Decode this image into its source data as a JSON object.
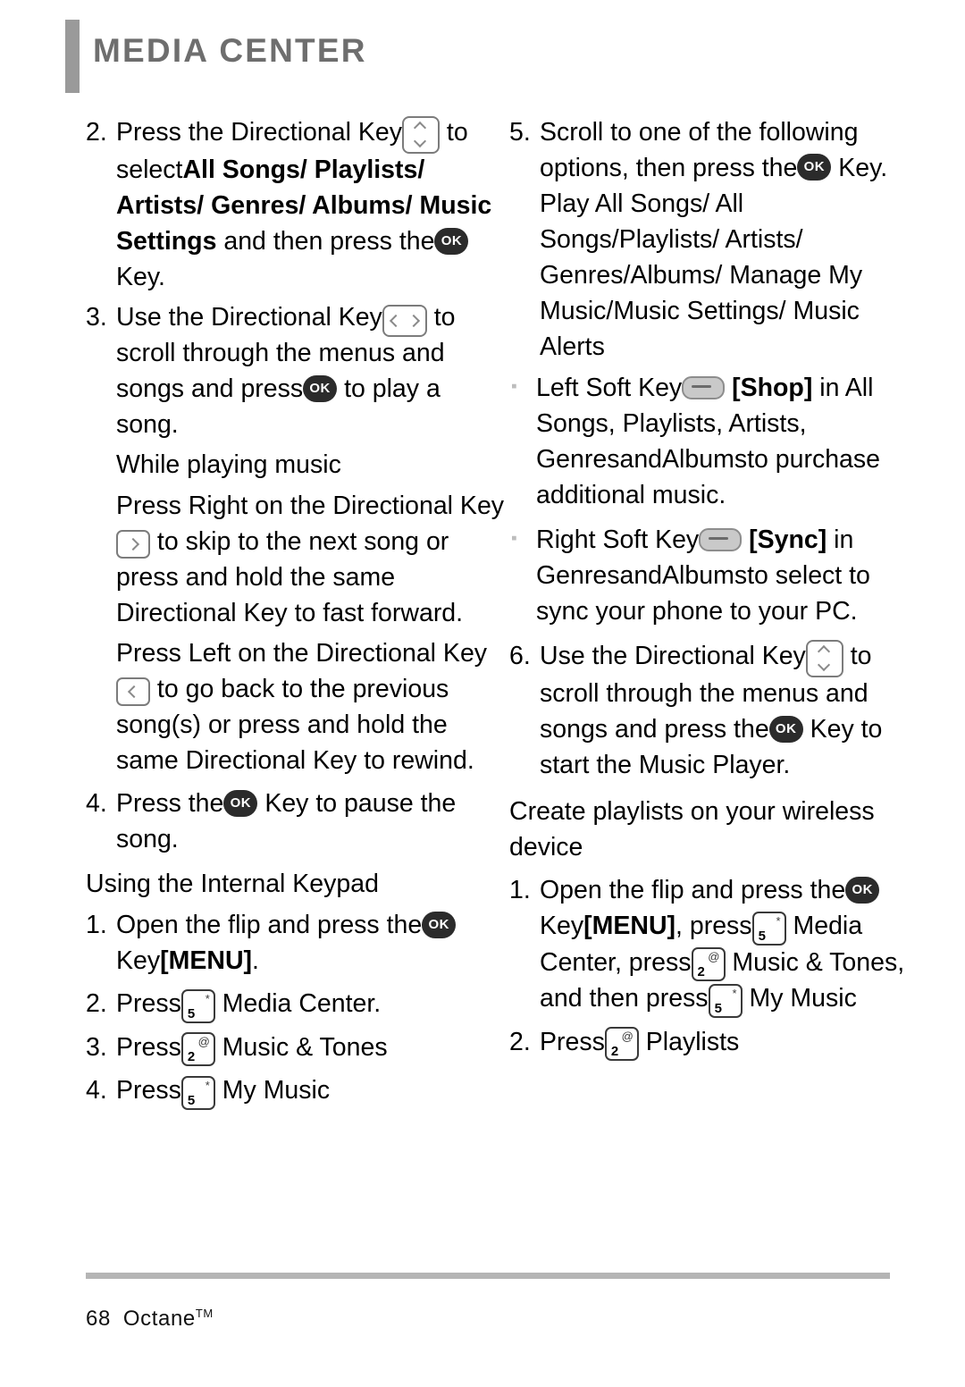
{
  "header": {
    "title": "MEDIA CENTER"
  },
  "footer": {
    "page_number": "68",
    "device_name": "Octane",
    "trademark": "TM"
  },
  "icons": {
    "ok_key": "OK",
    "key_5": "5",
    "key_5_sup": "*",
    "key_2": "2",
    "key_2_sup": "@"
  },
  "left_column": {
    "step2": {
      "num": "2.",
      "part1": "Press the Directional Key",
      "part2": "to select",
      "bold1": "All Songs/ Playlists/ Artists/ Genres/ Albums/ Music Settings",
      "part3": "and then press the",
      "part4": "Key."
    },
    "step3": {
      "num": "3.",
      "part1": "Use the Directional Key",
      "part2": "to scroll through the menus and songs and press",
      "part3": "to play a song."
    },
    "subhead_while_playing": "While playing music",
    "para_right": {
      "part1": "Press Right on the Directional Key",
      "part2": "to skip to the next song or press and hold the same Directional Key to fast forward."
    },
    "para_left": {
      "part1": "Press Left on the Directional Key",
      "part2": "to go back to the previous song(s) or press and hold the same Directional Key to rewind."
    },
    "step4": {
      "num": "4.",
      "part1": "Press the",
      "part2": "Key to pause the song."
    },
    "subhead_keypad": "Using the Internal Keypad",
    "kp1": {
      "num": "1.",
      "part1": "Open the flip and press the",
      "part2": "Key",
      "bold1": "[MENU]",
      "part3": "."
    },
    "kp2": {
      "num": "2.",
      "part1": "Press",
      "part2": "Media Center."
    },
    "kp3": {
      "num": "3.",
      "part1": "Press",
      "part2": "Music & Tones"
    },
    "kp4": {
      "num": "4.",
      "part1": "Press",
      "part2": "My Music"
    }
  },
  "right_column": {
    "step5": {
      "num": "5.",
      "part1": "Scroll to one of the following options, then press the",
      "part2": "Key.",
      "options": "Play All Songs/ All Songs/Playlists/ Artists/ Genres/Albums/ Manage My Music/Music Settings/ Music Alerts"
    },
    "bullet_left_soft": {
      "part1": "Left Soft Key",
      "bold1": "[Shop]",
      "part2": "in",
      "part3": "All Songs, Playlists, Artists, Genres",
      "part4": "and",
      "part5": "Albums",
      "part6": "to purchase additional music."
    },
    "bullet_right_soft": {
      "part1": "Right Soft Key",
      "bold1": "[Sync]",
      "part2": "in",
      "part3": "Genres",
      "part4": "and",
      "part5": "Albums",
      "part6": "to select to sync your phone to your PC."
    },
    "step6": {
      "num": "6.",
      "part1": "Use the Directional Key",
      "part2": "to scroll through the menus and songs and press the",
      "part3": "Key to start the Music Player."
    },
    "subhead_create": "Create playlists on your wireless device",
    "cp1": {
      "num": "1.",
      "part1": "Open the flip and press the",
      "part2": "Key",
      "bold1": "[MENU]",
      "part3": ", press",
      "part4": "Media Center, press",
      "part5": "Music & Tones, and then press",
      "part6": "My Music"
    },
    "cp2": {
      "num": "2.",
      "part1": "Press",
      "part2": "Playlists"
    }
  }
}
